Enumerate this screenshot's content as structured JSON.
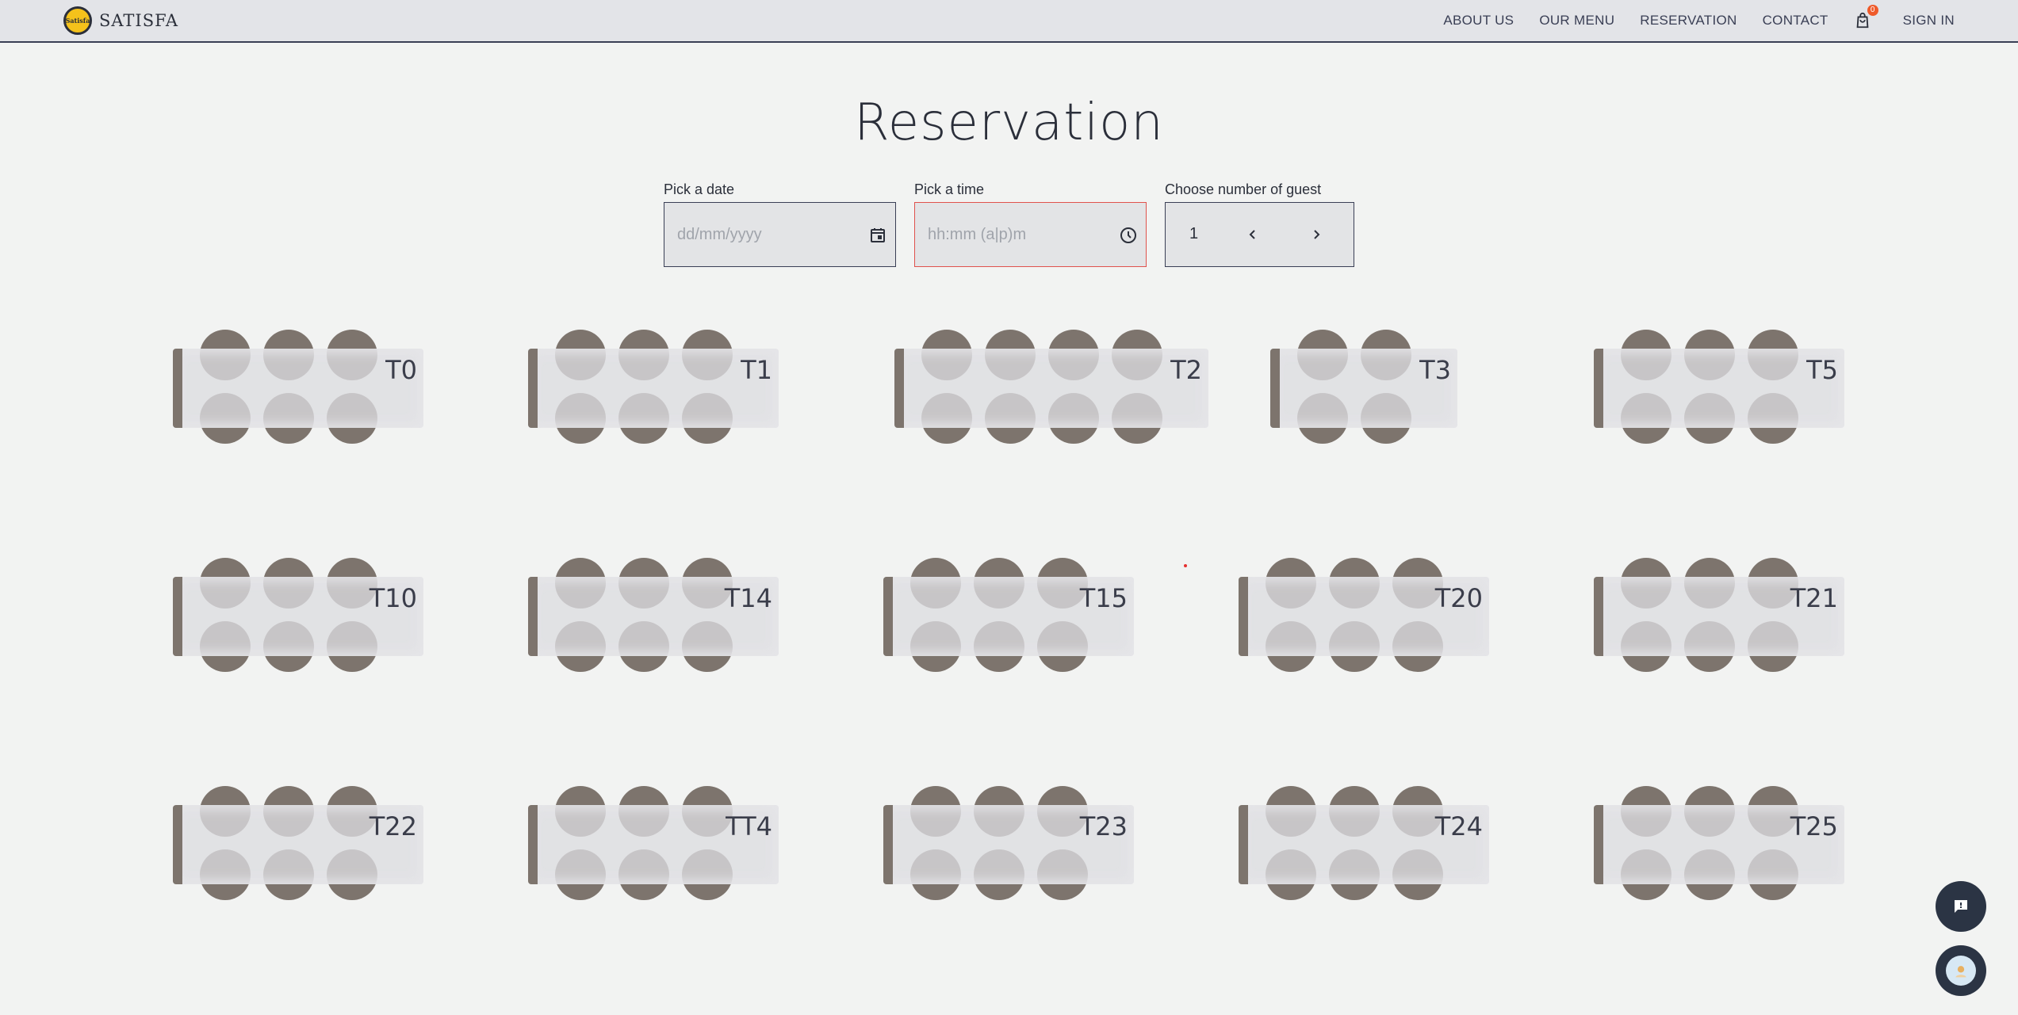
{
  "header": {
    "logo_text": "Satisfa",
    "brand": "SATISFA",
    "nav": [
      "ABOUT US",
      "OUR MENU",
      "RESERVATION",
      "CONTACT"
    ],
    "cart_count": "0",
    "signin": "SIGN IN"
  },
  "page": {
    "title": "Reservation"
  },
  "form": {
    "date_label": "Pick a date",
    "date_placeholder": "dd/mm/yyyy",
    "time_label": "Pick a time",
    "time_placeholder": "hh:mm (a|p)m",
    "guest_label": "Choose number of guest",
    "guest_count": "1"
  },
  "tables": [
    {
      "label": "T0",
      "seats": 6
    },
    {
      "label": "T1",
      "seats": 6
    },
    {
      "label": "T2",
      "seats": 8
    },
    {
      "label": "T3",
      "seats": 4
    },
    {
      "label": "T5",
      "seats": 6
    },
    {
      "label": "T10",
      "seats": 6
    },
    {
      "label": "T14",
      "seats": 6
    },
    {
      "label": "T15",
      "seats": 6
    },
    {
      "label": "T20",
      "seats": 6
    },
    {
      "label": "T21",
      "seats": 6
    },
    {
      "label": "T22",
      "seats": 6
    },
    {
      "label": "TT4",
      "seats": 6
    },
    {
      "label": "T23",
      "seats": 6
    },
    {
      "label": "T24",
      "seats": 6
    },
    {
      "label": "T25",
      "seats": 6
    }
  ],
  "colors": {
    "chair": "#7d746d",
    "header_bg": "#e3e4e8",
    "time_border": "#e0524d",
    "cart_badge": "#ef5a2a",
    "fab": "#2b3444"
  },
  "icons": [
    "calendar-icon",
    "clock-icon",
    "chevron-left-icon",
    "chevron-right-icon",
    "shopping-bag-icon",
    "chat-icon",
    "avatar-icon"
  ]
}
